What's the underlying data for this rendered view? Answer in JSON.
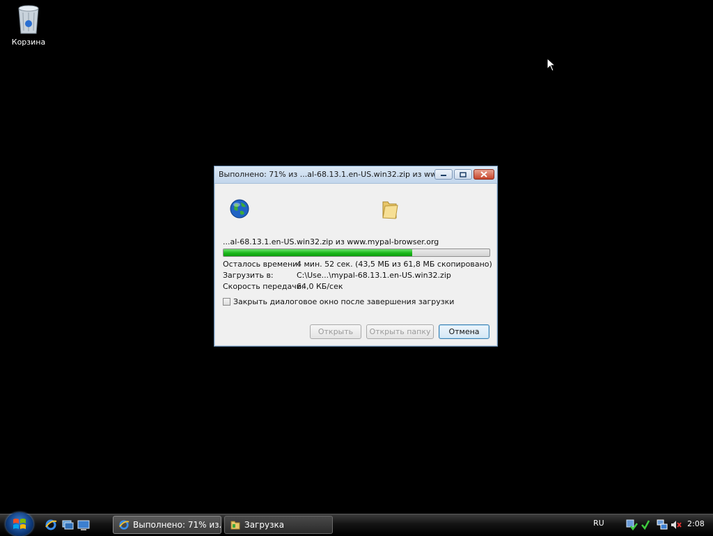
{
  "desktop": {
    "icons": [
      {
        "label": "Корзина",
        "icon": "recycle-bin-icon"
      }
    ]
  },
  "dialog": {
    "title": "Выполнено: 71% из ...al-68.13.1.en-US.win32.zip из www...",
    "file_line": "...al-68.13.1.en-US.win32.zip из www.mypal-browser.org",
    "progress_percent": 71,
    "info": [
      {
        "label": "Осталось времени:",
        "value": "4 мин. 52 сек. (43,5 МБ из 61,8 МБ скопировано)"
      },
      {
        "label": "Загрузить в:",
        "value": "C:\\Use...\\mypal-68.13.1.en-US.win32.zip"
      },
      {
        "label": "Скорость передачи:",
        "value": "64,0 КБ/сек"
      }
    ],
    "close_checkbox": {
      "label": "Закрыть диалоговое окно после завершения загрузки",
      "checked": false
    },
    "buttons": {
      "open": "Открыть",
      "open_folder": "Открыть папку",
      "cancel": "Отмена"
    }
  },
  "taskbar": {
    "tasks": [
      {
        "label": "Выполнено: 71% из...",
        "icon": "internet-explorer-icon"
      },
      {
        "label": "Загрузка",
        "icon": "download-folder-icon"
      }
    ],
    "language": "RU",
    "clock": "2:08"
  },
  "colors": {
    "desktop": "#000000",
    "progress": "#1bb81b",
    "taskbar": "#141414"
  }
}
